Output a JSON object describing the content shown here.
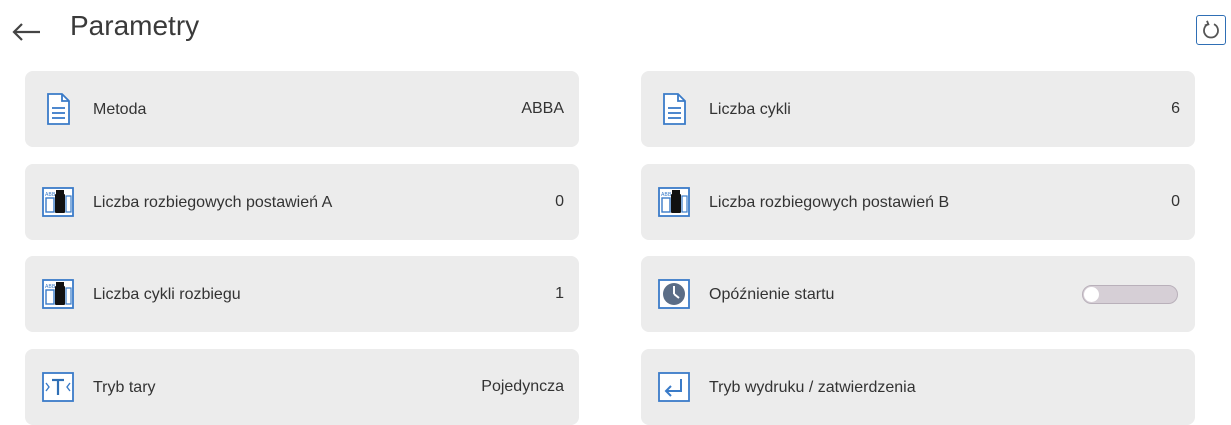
{
  "header": {
    "title": "Parametry"
  },
  "icons": {
    "back": "left-arrow-icon",
    "reset": "refresh-icon",
    "document": "document-icon",
    "weights": "weights-icon",
    "clock": "clock-icon",
    "tare": "tare-icon",
    "enter": "enter-icon"
  },
  "colors": {
    "accent": "#2f6fb5",
    "card": "#ececec",
    "toggle_off": "#d6cfd6"
  },
  "params": {
    "metoda": {
      "label": "Metoda",
      "value": "ABBA"
    },
    "liczba_cykli": {
      "label": "Liczba cykli",
      "value": "6"
    },
    "rozbiegowe_a": {
      "label": "Liczba rozbiegowych postawień A",
      "value": "0"
    },
    "rozbiegowe_b": {
      "label": "Liczba rozbiegowych postawień B",
      "value": "0"
    },
    "cykle_rozbiegu": {
      "label": "Liczba cykli rozbiegu",
      "value": "1"
    },
    "opoznienie": {
      "label": "Opóźnienie startu",
      "enabled": false
    },
    "tryb_tary": {
      "label": "Tryb tary",
      "value": "Pojedyncza"
    },
    "tryb_wydruku": {
      "label": "Tryb wydruku / zatwierdzenia"
    }
  }
}
